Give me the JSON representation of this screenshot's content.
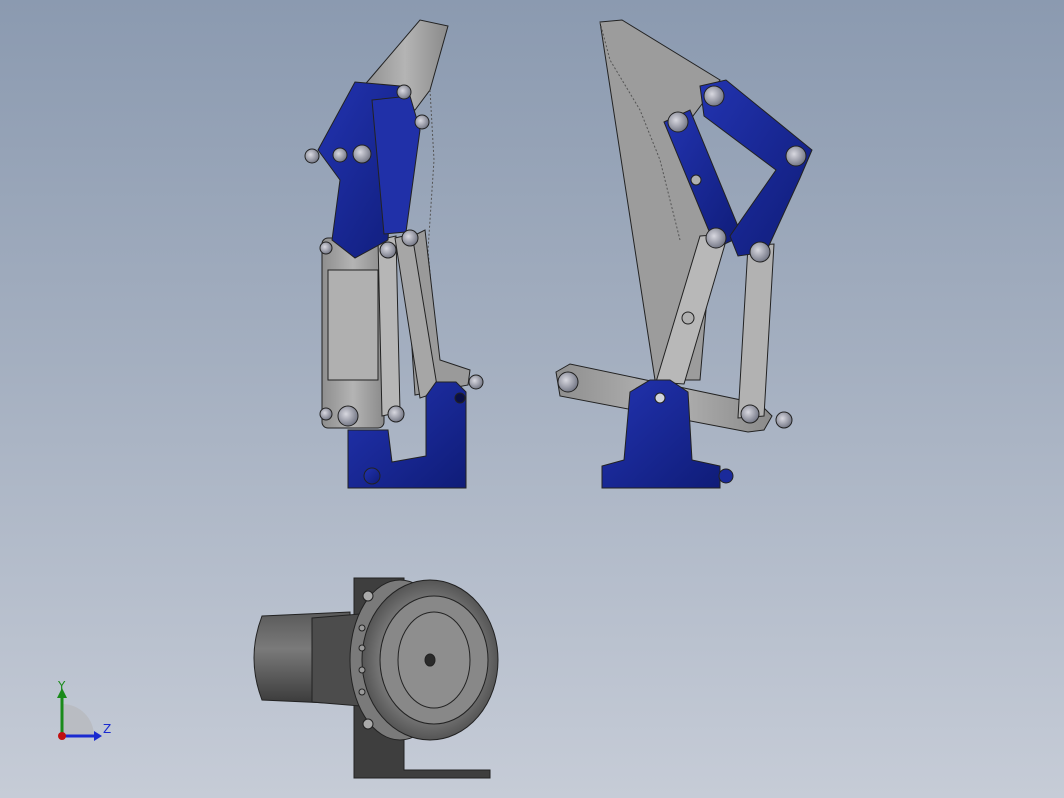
{
  "view": {
    "colors": {
      "bg_top": "#8b9ab0",
      "bg_bottom": "#c6ccd7",
      "blue_part": "#1a2a9a",
      "blue_dark": "#0e1a66",
      "grey_part": "#a8a8a8",
      "grey_dark": "#6a6a6a",
      "axis_y": "#1a8a1a",
      "axis_z": "#1a2ad0",
      "axis_x": "#c01010"
    },
    "triad": {
      "y_label": "Y",
      "z_label": "Z"
    },
    "components": [
      {
        "name": "gripper-side-view",
        "icon": "mechanism-side-view"
      },
      {
        "name": "gripper-front-view",
        "icon": "mechanism-front-view"
      },
      {
        "name": "gripper-top-view",
        "icon": "mechanism-top-view"
      }
    ]
  }
}
